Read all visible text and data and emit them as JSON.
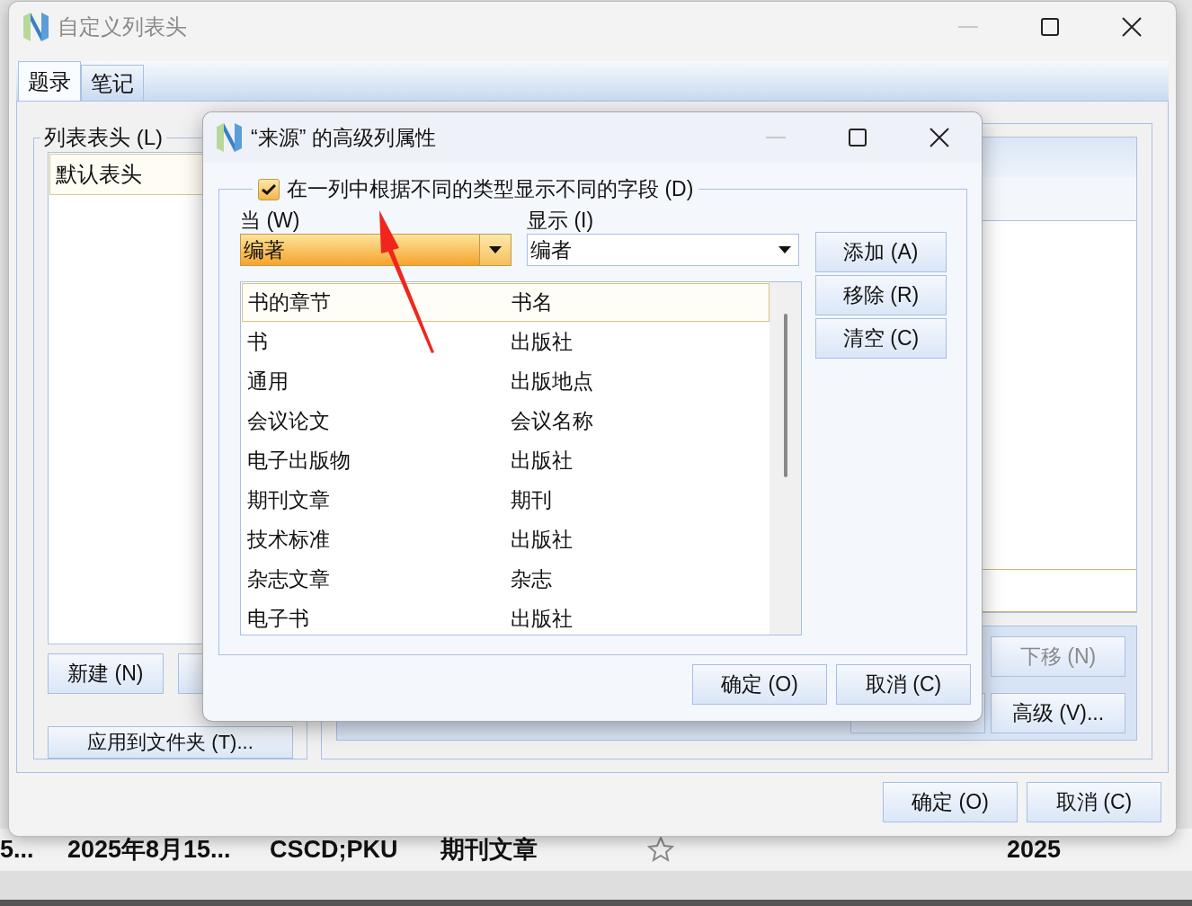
{
  "background_row": {
    "cells": [
      "5...",
      "2025年8月15...",
      "CSCD;PKU",
      "期刊文章",
      "2025"
    ],
    "starred": false
  },
  "main_window": {
    "title": "自定义列表头",
    "tabs": [
      {
        "label": "题录",
        "selected": true
      },
      {
        "label": "笔记",
        "selected": false
      }
    ],
    "header_group": {
      "label": "列表表头 (L)",
      "items": [
        {
          "label": "默认表头",
          "selected": true
        }
      ],
      "new_button": "新建 (N)",
      "apply_button": "应用到文件夹 (T)..."
    },
    "field_buttons": [
      {
        "label": "下移 (N)",
        "disabled": true
      },
      {
        "label": "高级 (V)...",
        "disabled": false
      }
    ],
    "buttons": [
      "确定 (O)",
      "取消 (C)"
    ]
  },
  "dialog": {
    "title": "“来源” 的高级列属性",
    "option": {
      "label": "在一列中根据不同的类型显示不同的字段 (D)",
      "checked": true
    },
    "when": {
      "label": "当 (W)",
      "value": "编著",
      "focused": true
    },
    "show": {
      "label": "显示 (I)",
      "value": "编者",
      "focused": false
    },
    "side_buttons": [
      "添加 (A)",
      "移除 (R)",
      "清空 (C)"
    ],
    "mappings": [
      {
        "type": "书的章节",
        "field": "书名",
        "selected": true
      },
      {
        "type": "书",
        "field": "出版社",
        "selected": false
      },
      {
        "type": "通用",
        "field": "出版地点",
        "selected": false
      },
      {
        "type": "会议论文",
        "field": "会议名称",
        "selected": false
      },
      {
        "type": "电子出版物",
        "field": "出版社",
        "selected": false
      },
      {
        "type": "期刊文章",
        "field": "期刊",
        "selected": false
      },
      {
        "type": "技术标准",
        "field": "出版社",
        "selected": false
      },
      {
        "type": "杂志文章",
        "field": "杂志",
        "selected": false
      },
      {
        "type": "电子书",
        "field": "出版社",
        "selected": false
      }
    ],
    "buttons": [
      "确定 (O)",
      "取消 (C)"
    ]
  }
}
